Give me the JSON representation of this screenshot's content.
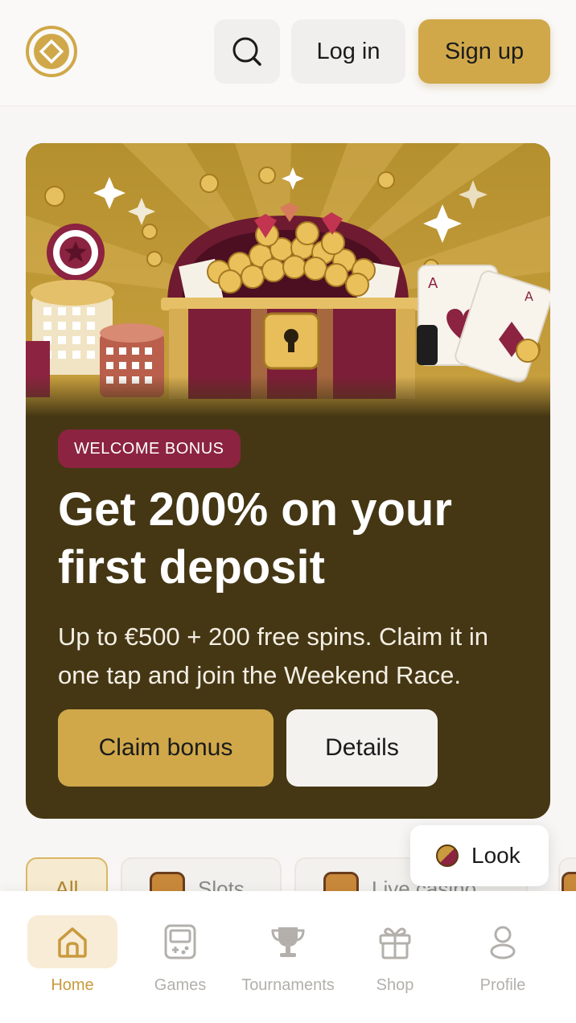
{
  "header": {
    "logo_icon": "diamond-coin-logo",
    "search_icon": "search-icon",
    "login_label": "Log in",
    "signup_label": "Sign up"
  },
  "hero": {
    "badge": "WELCOME BONUS",
    "title": "Get 200% on your first deposit",
    "subtitle": "Up to €500 + 200 free spins. Claim it in one tap and join the Weekend Race.",
    "claim_label": "Claim bonus",
    "details_label": "Details"
  },
  "categories": [
    {
      "label": "All",
      "active": true
    },
    {
      "label": "Slots",
      "active": false
    },
    {
      "label": "Live casino",
      "active": false
    }
  ],
  "floating": {
    "label": "Look"
  },
  "nav": {
    "items": [
      {
        "label": "Home",
        "icon": "home-icon",
        "active": true
      },
      {
        "label": "Games",
        "icon": "gameboy-icon",
        "active": false
      },
      {
        "label": "Tournaments",
        "icon": "trophy-icon",
        "active": false
      },
      {
        "label": "Shop",
        "icon": "gift-icon",
        "active": false
      },
      {
        "label": "Profile",
        "icon": "user-icon",
        "active": false
      }
    ]
  },
  "colors": {
    "accent": "#d0a84a",
    "hero_bg": "#453714",
    "badge": "#8b2341",
    "page_bg": "#f8f6f4"
  }
}
